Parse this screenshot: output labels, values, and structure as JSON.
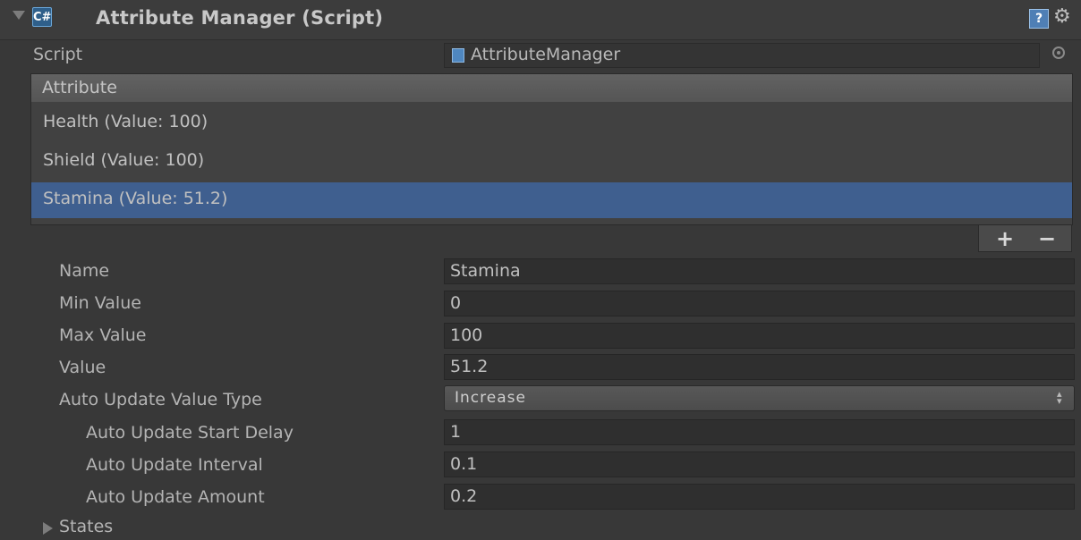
{
  "header": {
    "title": "Attribute Manager (Script)",
    "script_badge_glyph": "C#",
    "help_glyph": "?",
    "gear_glyph": "⚙"
  },
  "script_row": {
    "label": "Script",
    "value": "AttributeManager"
  },
  "attribute_list": {
    "header": "Attribute",
    "items": [
      {
        "label": "Health (Value: 100)",
        "selected": false
      },
      {
        "label": "Shield (Value: 100)",
        "selected": false
      },
      {
        "label": "Stamina (Value: 51.2)",
        "selected": true
      }
    ],
    "add_label": "+",
    "remove_label": "−"
  },
  "properties": {
    "name": {
      "label": "Name",
      "value": "Stamina"
    },
    "min_value": {
      "label": "Min Value",
      "value": "0"
    },
    "max_value": {
      "label": "Max Value",
      "value": "100"
    },
    "value": {
      "label": "Value",
      "value": "51.2"
    },
    "auto_update_type": {
      "label": "Auto Update Value Type",
      "value": "Increase",
      "arrow": "▲▼"
    },
    "start_delay": {
      "label": "Auto Update Start Delay",
      "value": "1"
    },
    "interval": {
      "label": "Auto Update Interval",
      "value": "0.1"
    },
    "amount": {
      "label": "Auto Update Amount",
      "value": "0.2"
    }
  },
  "states": {
    "label": "States"
  },
  "colors": {
    "background": "#383838",
    "selected_row": "#3f5f8f",
    "field_bg": "#2f2f2f"
  }
}
